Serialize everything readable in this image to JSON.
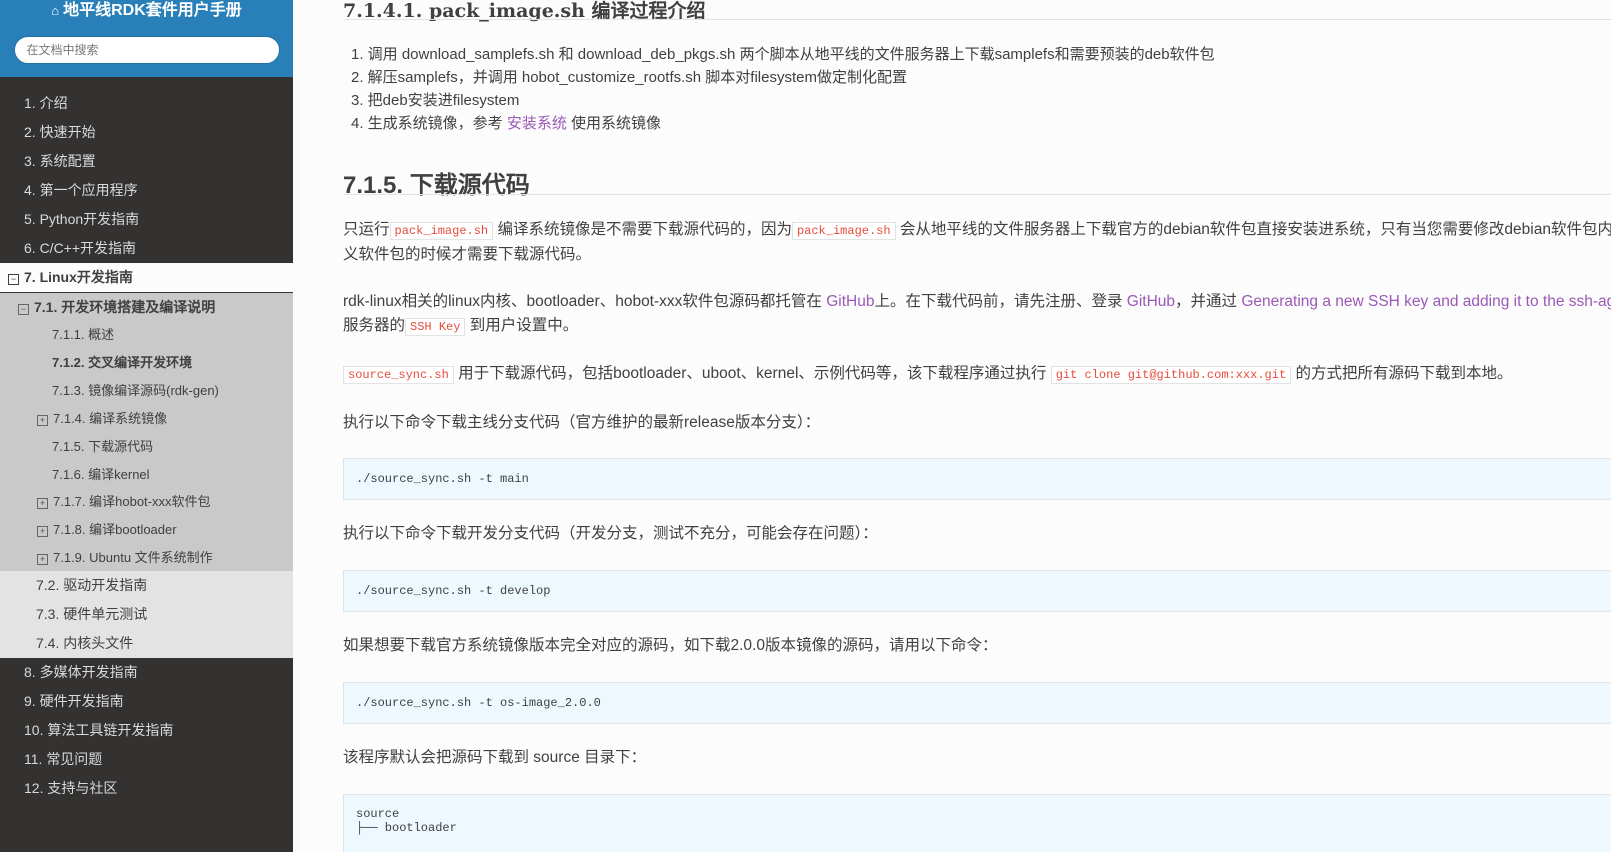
{
  "sidebar": {
    "home_icon": "home-icon",
    "project_title": "地平线RDK套件用户手册",
    "search_placeholder": "在文档中搜索",
    "toggle_collapse": "−",
    "toggle_expand": "+",
    "items": [
      {
        "label": "1. 介绍",
        "level": 1
      },
      {
        "label": "2. 快速开始",
        "level": 1
      },
      {
        "label": "3. 系统配置",
        "level": 1
      },
      {
        "label": "4. 第一个应用程序",
        "level": 1
      },
      {
        "label": "5. Python开发指南",
        "level": 1
      },
      {
        "label": "6. C/C++开发指南",
        "level": 1
      },
      {
        "label": "7. Linux开发指南",
        "level": 1,
        "current": true,
        "expanded": true
      },
      {
        "label": "7.1. 开发环境搭建及编译说明",
        "level": 2,
        "current": true,
        "expanded": true
      },
      {
        "label": "7.1.1. 概述",
        "level": 3
      },
      {
        "label": "7.1.2. 交叉编译开发环境",
        "level": 3,
        "current": true
      },
      {
        "label": "7.1.3. 镜像编译源码(rdk-gen)",
        "level": 3
      },
      {
        "label": "7.1.4. 编译系统镜像",
        "level": 3,
        "collapsed": true
      },
      {
        "label": "7.1.5. 下载源代码",
        "level": 3
      },
      {
        "label": "7.1.6. 编译kernel",
        "level": 3
      },
      {
        "label": "7.1.7. 编译hobot-xxx软件包",
        "level": 3,
        "collapsed": true
      },
      {
        "label": "7.1.8. 编译bootloader",
        "level": 3,
        "collapsed": true
      },
      {
        "label": "7.1.9. Ubuntu 文件系统制作",
        "level": 3,
        "collapsed": true
      },
      {
        "label": "7.2. 驱动开发指南",
        "level": 2
      },
      {
        "label": "7.3. 硬件单元测试",
        "level": 2
      },
      {
        "label": "7.4. 内核头文件",
        "level": 2
      },
      {
        "label": "8. 多媒体开发指南",
        "level": 1
      },
      {
        "label": "9. 硬件开发指南",
        "level": 1
      },
      {
        "label": "10. 算法工具链开发指南",
        "level": 1
      },
      {
        "label": "11. 常见问题",
        "level": 1
      },
      {
        "label": "12. 支持与社区",
        "level": 1
      }
    ]
  },
  "content": {
    "subsection_title": "7.1.4.1. pack_image.sh 编译过程介绍",
    "steps": [
      {
        "text": "1. 调用 download_samplefs.sh 和 download_deb_pkgs.sh 两个脚本从地平线的文件服务器上下载samplefs和需要预装的deb软件包"
      },
      {
        "text": "2. 解压samplefs，并调用 hobot_customize_rootfs.sh 脚本对filesystem做定制化配置"
      },
      {
        "text": "3. 把deb安装进filesystem"
      },
      {
        "pre": "4. 生成系统镜像，参考 ",
        "link": "安装系统",
        "post": " 使用系统镜像"
      }
    ],
    "section_title": "7.1.5. 下载源代码",
    "p1": {
      "t1": "只运行",
      "code1": "pack_image.sh",
      "t2": " 编译系统镜像是不需要下载源代码的，因为",
      "code2": "pack_image.sh",
      "t3": " 会从地平线的文件服务器上下载官方的debian软件包直接安装进系统，只有当您需要修改debian软件包内容或者自定",
      "line2": "义软件包的时候才需要下载源代码。"
    },
    "p2": {
      "t1": "rdk-linux相关的linux内核、bootloader、hobot-xxx软件包源码都托管在 ",
      "link1": "GitHub",
      "t2": "上。在下载代码前，请先注册、登录 ",
      "link2": "GitHub",
      "t3": "，并通过 ",
      "link3": "Generating a new SSH key and adding it to the ssh-agent",
      "line2_pre": "服务器的",
      "code": "SSH Key",
      "line2_post": " 到用户设置中。"
    },
    "p3": {
      "code1": "source_sync.sh",
      "t1": " 用于下载源代码，包括bootloader、uboot、kernel、示例代码等，该下载程序通过执行 ",
      "code2": "git clone git@github.com:xxx.git",
      "t2": " 的方式把所有源码下载到本地。"
    },
    "p4": "执行以下命令下载主线分支代码（官方维护的最新release版本分支）：",
    "cmd1": "./source_sync.sh -t main",
    "p5": "执行以下命令下载开发分支代码（开发分支，测试不充分，可能会存在问题）：",
    "cmd2": "./source_sync.sh -t develop",
    "p6": "如果想要下载官方系统镜像版本完全对应的源码，如下载2.0.0版本镜像的源码，请用以下命令：",
    "cmd3": "./source_sync.sh -t os-image_2.0.0",
    "p7": "该程序默认会把源码下载到 source 目录下：",
    "tree": "source\n├── bootloader"
  },
  "colors": {
    "sidebar_bg": "#343131",
    "header_bg": "#2980b9",
    "link": "#9b59b6",
    "code_text": "#e74c3c",
    "codeblock_bg": "#eef8ff"
  }
}
